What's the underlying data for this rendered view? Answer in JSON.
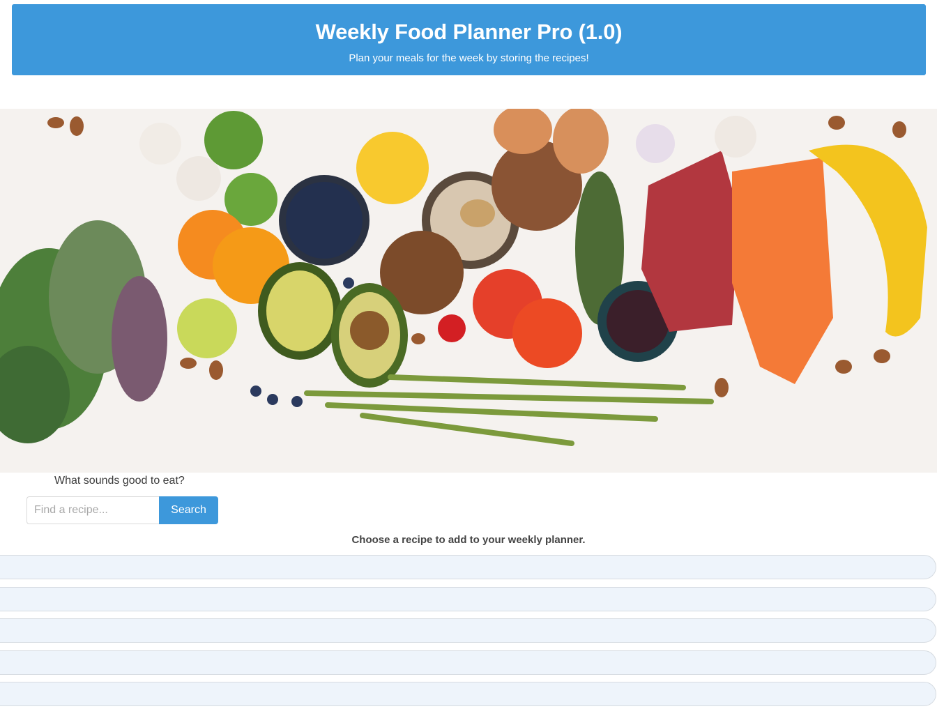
{
  "header": {
    "title": "Weekly Food Planner Pro (1.0)",
    "subtitle": "Plan your meals for the week by storing the recipes!"
  },
  "hero": {
    "icon": "food-ingredients-banner"
  },
  "search": {
    "prompt": "What sounds good to eat?",
    "placeholder": "Find a recipe...",
    "value": "",
    "button_label": "Search"
  },
  "results": {
    "heading": "Choose a recipe to add to your weekly planner.",
    "items": [
      "",
      "",
      "",
      "",
      ""
    ]
  },
  "colors": {
    "accent": "#3d98db",
    "list_bg": "#eef4fb"
  }
}
